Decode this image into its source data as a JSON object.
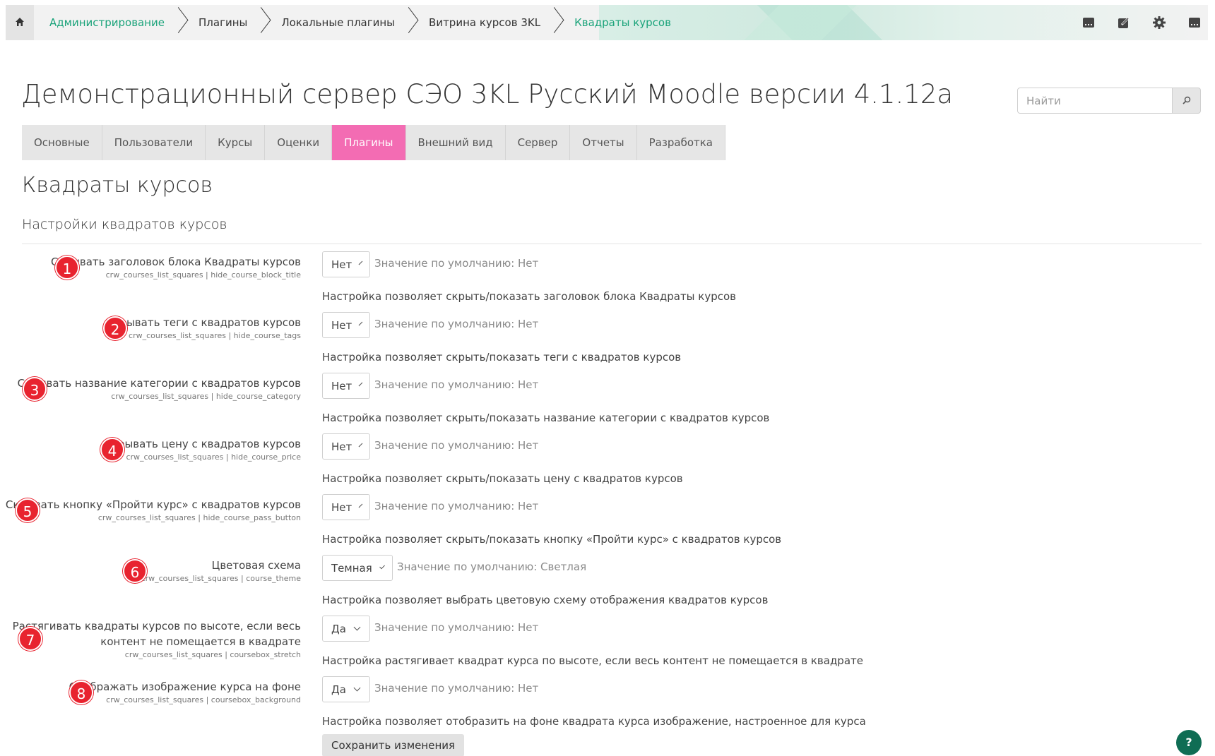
{
  "breadcrumb": [
    {
      "label": "Администрирование",
      "link": true
    },
    {
      "label": "Плагины",
      "link": false
    },
    {
      "label": "Локальные плагины",
      "link": false
    },
    {
      "label": "Витрина курсов 3KL",
      "link": false
    },
    {
      "label": "Квадраты курсов",
      "link": true
    }
  ],
  "site_title": "Демонстрационный сервер СЭО 3KL Русский Moodle версии 4.1.12a",
  "search": {
    "placeholder": "Найти"
  },
  "tabs": [
    "Основные",
    "Пользователи",
    "Курсы",
    "Оценки",
    "Плагины",
    "Внешний вид",
    "Сервер",
    "Отчеты",
    "Разработка"
  ],
  "active_tab": "Плагины",
  "page_heading": "Квадраты курсов",
  "section_heading": "Настройки квадратов курсов",
  "settings": [
    {
      "num": "1",
      "title": [
        "Скрывать заголовок блока Квадраты курсов"
      ],
      "key": "crw_courses_list_squares | hide_course_block_title",
      "value": "Нет",
      "default": "Значение по умолчанию: Нет",
      "desc": "Настройка позволяет скрыть/показать заголовок блока Квадраты курсов"
    },
    {
      "num": "2",
      "title": [
        "Скрывать теги с квадратов курсов"
      ],
      "key": "crw_courses_list_squares | hide_course_tags",
      "value": "Нет",
      "default": "Значение по умолчанию: Нет",
      "desc": "Настройка позволяет скрыть/показать теги с квадратов курсов"
    },
    {
      "num": "3",
      "title": [
        "Скрывать название категории с квадратов курсов"
      ],
      "key": "crw_courses_list_squares | hide_course_category",
      "value": "Нет",
      "default": "Значение по умолчанию: Нет",
      "desc": "Настройка позволяет скрыть/показать название категории с квадратов курсов"
    },
    {
      "num": "4",
      "title": [
        "Скрывать цену с квадратов курсов"
      ],
      "key": "crw_courses_list_squares | hide_course_price",
      "value": "Нет",
      "default": "Значение по умолчанию: Нет",
      "desc": "Настройка позволяет скрыть/показать цену с квадратов курсов"
    },
    {
      "num": "5",
      "title": [
        "Скрывать кнопку «Пройти курс» с квадратов курсов"
      ],
      "key": "crw_courses_list_squares | hide_course_pass_button",
      "value": "Нет",
      "default": "Значение по умолчанию: Нет",
      "desc": "Настройка позволяет скрыть/показать кнопку «Пройти курс» с квадратов курсов"
    },
    {
      "num": "6",
      "title": [
        "Цветовая схема"
      ],
      "key": "crw_courses_list_squares | course_theme",
      "value": "Темная",
      "default": "Значение по умолчанию: Светлая",
      "desc": "Настройка позволяет выбрать цветовую схему отображения квадратов курсов"
    },
    {
      "num": "7",
      "title": [
        "Растягивать квадраты курсов по высоте, если весь",
        "контент не помещается в квадрате"
      ],
      "key": "crw_courses_list_squares | coursebox_stretch",
      "value": "Да",
      "default": "Значение по умолчанию: Нет",
      "desc": "Настройка растягивает квадрат курса по высоте, если весь контент не помещается в квадрате"
    },
    {
      "num": "8",
      "title": [
        "Отображать изображение курса на фоне"
      ],
      "key": "crw_courses_list_squares | coursebox_background",
      "value": "Да",
      "default": "Значение по умолчанию: Нет",
      "desc": "Настройка позволяет отобразить на фоне квадрата курса изображение, настроенное для курса"
    }
  ],
  "save_label": "Сохранить изменения",
  "help_label": "?",
  "icons": {
    "home": "home-icon",
    "toolbar": [
      "block-icon",
      "edit-icon",
      "gear-icon",
      "block-icon"
    ],
    "search": "search-icon"
  },
  "colors": {
    "accent_link": "#1aa37a",
    "active_tab": "#f36cb3",
    "badge": "#e8232f",
    "help": "#0f6d54"
  }
}
